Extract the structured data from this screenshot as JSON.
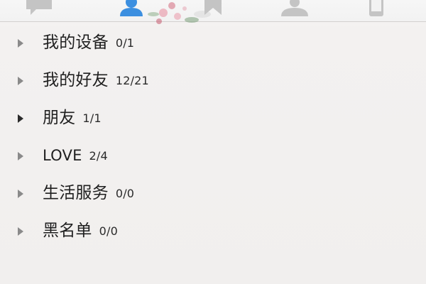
{
  "tabs": [
    {
      "icon": "chat-bubble-icon",
      "active": false
    },
    {
      "icon": "contacts-person-icon",
      "active": true
    },
    {
      "icon": "star-favorites-icon",
      "active": false
    },
    {
      "icon": "recent-person-icon",
      "active": false
    },
    {
      "icon": "mobile-phone-icon",
      "active": false
    }
  ],
  "colors": {
    "active_tab": "#3c8fe0",
    "inactive_tab": "#c4c4c4",
    "arrow": "#8a8a8a",
    "arrow_dark": "#2b2b2b",
    "background": "#f3f1f0",
    "divider": "#d2d0cf"
  },
  "groups": [
    {
      "name": "我的设备",
      "count": "0/1"
    },
    {
      "name": "我的好友",
      "count": "12/21"
    },
    {
      "name": "朋友",
      "count": "1/1"
    },
    {
      "name": "LOVE",
      "count": "2/4"
    },
    {
      "name": "生活服务",
      "count": "0/0"
    },
    {
      "name": "黑名单",
      "count": "0/0"
    }
  ]
}
